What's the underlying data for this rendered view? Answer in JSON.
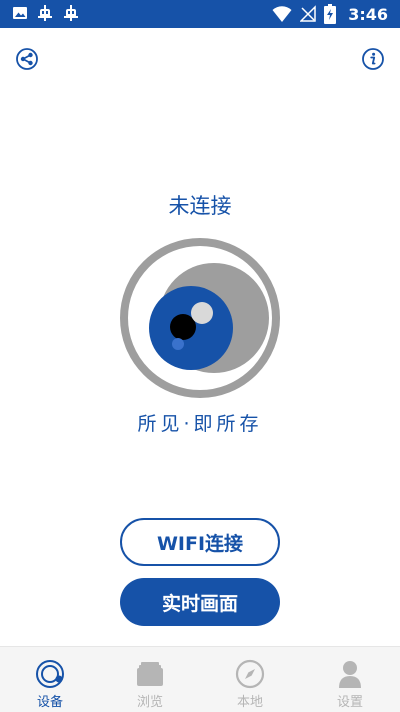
{
  "status_bar": {
    "time": "3:46",
    "icons": [
      "image-notification-icon",
      "bug-notification-icon",
      "bug-notification-icon",
      "wifi-icon",
      "no-signal-icon",
      "battery-charging-icon"
    ]
  },
  "header": {
    "left_icon": "share-icon",
    "right_icon": "info-icon"
  },
  "main": {
    "connection_status": "未连接",
    "slogan": "所见·即所存",
    "wifi_button": "WIFI连接",
    "live_button": "实时画面"
  },
  "nav": {
    "items": [
      {
        "label": "设备",
        "icon": "device-icon",
        "active": true
      },
      {
        "label": "浏览",
        "icon": "gallery-icon",
        "active": false
      },
      {
        "label": "本地",
        "icon": "compass-icon",
        "active": false
      },
      {
        "label": "设置",
        "icon": "person-icon",
        "active": false
      }
    ]
  },
  "colors": {
    "primary": "#1652a8",
    "camera_gray": "#9e9e9e",
    "nav_inactive": "#b5b5b5"
  }
}
